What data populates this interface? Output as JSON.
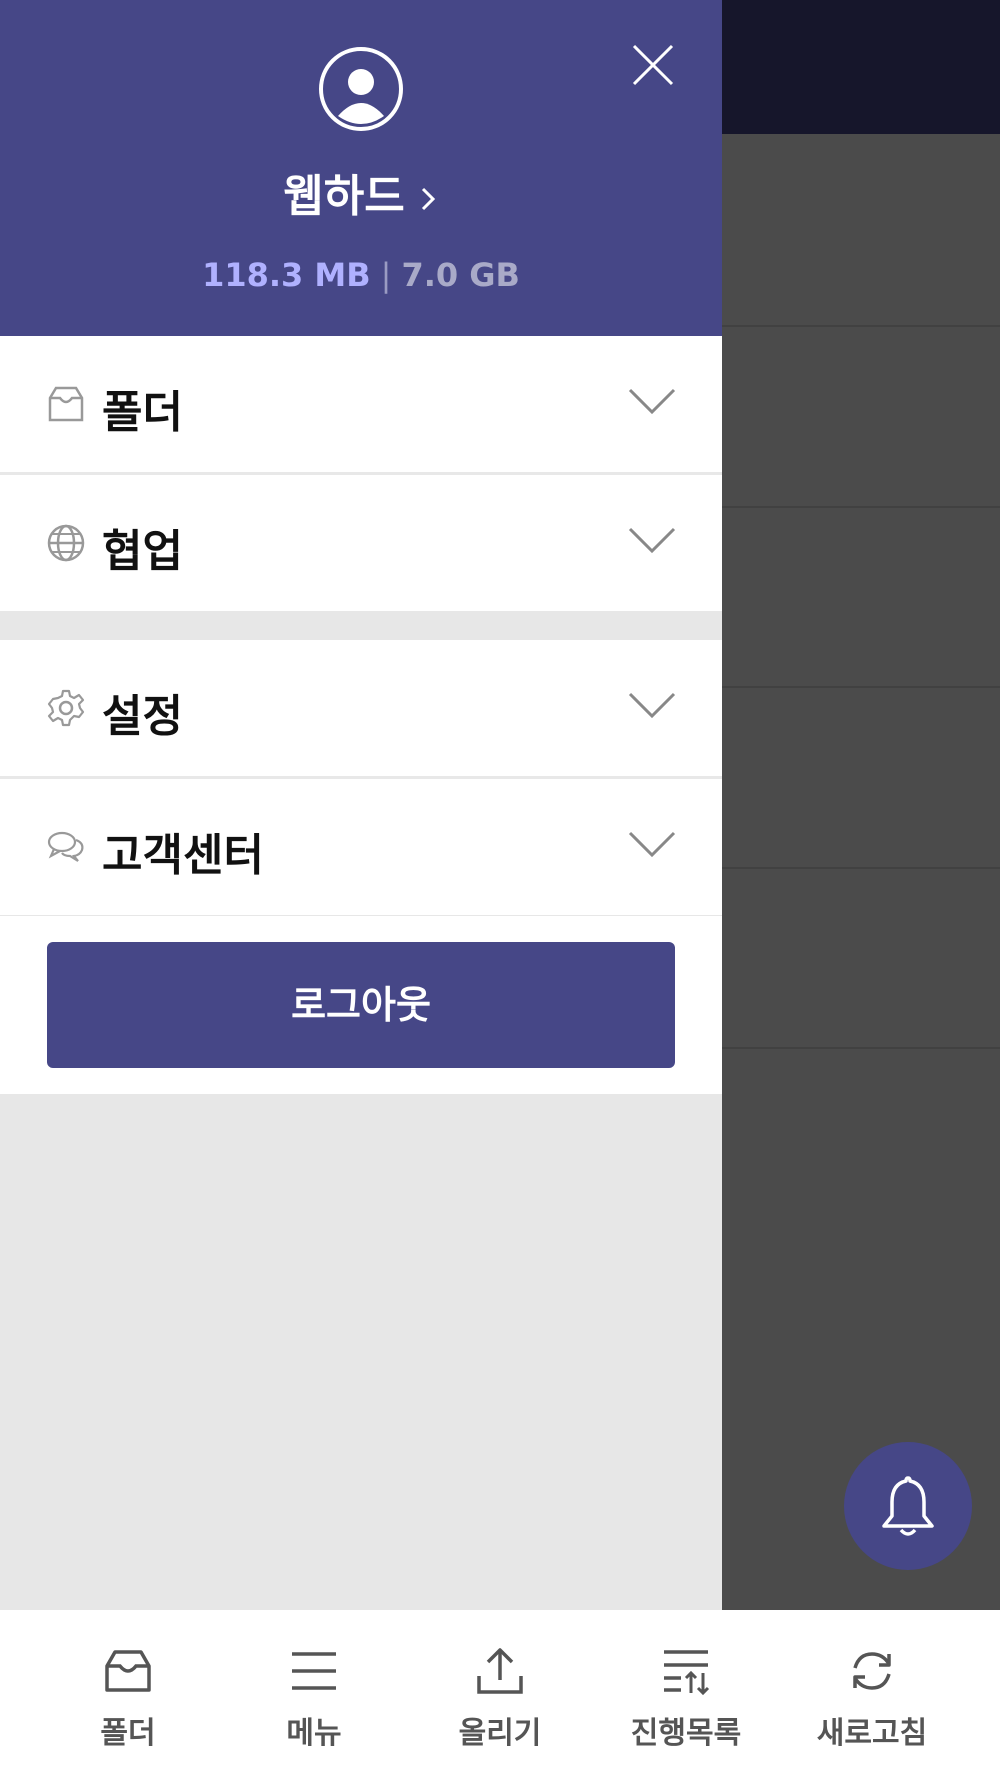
{
  "drawer": {
    "account_label": "웹하드",
    "storage_used": "118.3 MB",
    "storage_separator": "|",
    "storage_total": "7.0 GB",
    "accent_color": "#464787",
    "menu": [
      {
        "label": "폴더",
        "icon": "inbox-icon"
      },
      {
        "label": "협업",
        "icon": "globe-icon"
      },
      {
        "label": "설정",
        "icon": "gear-icon"
      },
      {
        "label": "고객센터",
        "icon": "chat-bubbles-icon"
      }
    ],
    "logout_label": "로그아웃"
  },
  "bottom_nav": {
    "items": [
      {
        "label": "폴더",
        "icon": "inbox-icon"
      },
      {
        "label": "메뉴",
        "icon": "menu-icon"
      },
      {
        "label": "올리기",
        "icon": "upload-icon"
      },
      {
        "label": "진행목록",
        "icon": "transfer-list-icon"
      },
      {
        "label": "새로고침",
        "icon": "refresh-icon"
      }
    ]
  },
  "fab": {
    "icon": "bell-icon"
  }
}
